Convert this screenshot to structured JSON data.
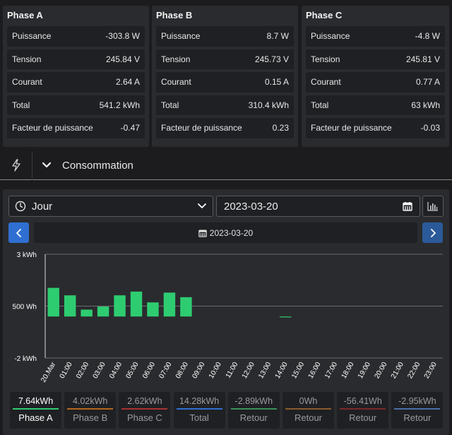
{
  "phases": [
    {
      "title": "Phase A",
      "rows": [
        {
          "label": "Puissance",
          "value": "-303.8 W"
        },
        {
          "label": "Tension",
          "value": "245.84 V"
        },
        {
          "label": "Courant",
          "value": "2.64 A"
        },
        {
          "label": "Total",
          "value": "541.2 kWh"
        },
        {
          "label": "Facteur de puissance",
          "value": "-0.47"
        }
      ]
    },
    {
      "title": "Phase B",
      "rows": [
        {
          "label": "Puissance",
          "value": "8.7 W"
        },
        {
          "label": "Tension",
          "value": "245.73 V"
        },
        {
          "label": "Courant",
          "value": "0.15 A"
        },
        {
          "label": "Total",
          "value": "310.4 kWh"
        },
        {
          "label": "Facteur de puissance",
          "value": "0.23"
        }
      ]
    },
    {
      "title": "Phase C",
      "rows": [
        {
          "label": "Puissance",
          "value": "-4.8 W"
        },
        {
          "label": "Tension",
          "value": "245.81 V"
        },
        {
          "label": "Courant",
          "value": "0.77 A"
        },
        {
          "label": "Total",
          "value": "63 kWh"
        },
        {
          "label": "Facteur de puissance",
          "value": "-0.03"
        }
      ]
    }
  ],
  "section": {
    "title": "Consommation",
    "icon": "lightning-icon"
  },
  "controls": {
    "period": "Jour",
    "date_input": "2023-03-20",
    "date_label": "2023-03-20"
  },
  "colors": {
    "bar": "#2ecc71",
    "accent": "#2f6fd1"
  },
  "chart_data": {
    "type": "bar",
    "categories": [
      "20.Mar",
      "01:00",
      "02:00",
      "03:00",
      "04:00",
      "05:00",
      "06:00",
      "07:00",
      "08:00",
      "09:00",
      "10:00",
      "11:00",
      "12:00",
      "13:00",
      "14:00",
      "15:00",
      "16:00",
      "17:00",
      "18:00",
      "19:00",
      "20:00",
      "21:00",
      "22:00",
      "23:00"
    ],
    "values": [
      1380,
      1020,
      330,
      480,
      1020,
      1200,
      680,
      1150,
      930,
      0,
      0,
      0,
      0,
      0,
      -20,
      0,
      0,
      0,
      0,
      0,
      0,
      0,
      0,
      0
    ],
    "ytick_labels": [
      "3 kWh",
      "500 Wh",
      "-2 kWh"
    ],
    "ylim": [
      -2000,
      3000
    ],
    "baseline": 0,
    "grid": true
  },
  "totals": [
    {
      "value": "7.64kWh",
      "label": "Phase A",
      "line_color": "#2ecc71",
      "active": true
    },
    {
      "value": "4.02kWh",
      "label": "Phase B",
      "line_color": "#b5651d",
      "active": false
    },
    {
      "value": "2.62kWh",
      "label": "Phase C",
      "line_color": "#a93232",
      "active": false
    },
    {
      "value": "14.28kWh",
      "label": "Total",
      "line_color": "#2f6fd1",
      "active": false
    },
    {
      "value": "-2.89kWh",
      "label": "Retour",
      "line_color": "#3a8f5a",
      "active": false
    },
    {
      "value": "0Wh",
      "label": "Retour",
      "line_color": "#8a5a2b",
      "active": false
    },
    {
      "value": "-56.41Wh",
      "label": "Retour",
      "line_color": "#7a2a2a",
      "active": false
    },
    {
      "value": "-2.95kWh",
      "label": "Retour",
      "line_color": "#4a6fa8",
      "active": false
    }
  ]
}
